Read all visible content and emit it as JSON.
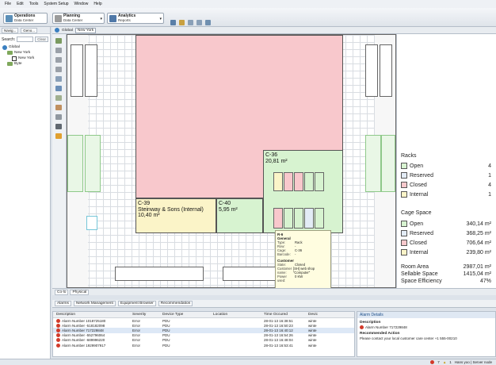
{
  "menu": [
    "File",
    "Edit",
    "Tools",
    "System Setup",
    "Window",
    "Help"
  ],
  "launchers": [
    {
      "title": "Operations",
      "sub": "Data Center"
    },
    {
      "title": "Planning",
      "sub": "Data Center"
    },
    {
      "title": "Analytics",
      "sub": "Reports"
    }
  ],
  "nav": {
    "tabs": [
      "Navig...",
      "Geno..."
    ],
    "search_label": "Search:",
    "clear_label": "Clear",
    "tree": [
      "Global",
      "New York",
      "New York",
      "Byte"
    ]
  },
  "editor": {
    "tab": "Global",
    "crumb": "New York"
  },
  "rooms": {
    "c36": {
      "name": "C-36",
      "area": "20,81 m²"
    },
    "c39": {
      "name": "C-39",
      "tenant": "Steinway & Sons (Internal)",
      "area": "10,40 m²"
    },
    "c40": {
      "name": "C-40",
      "area": "5,95 m²"
    }
  },
  "tooltip": {
    "title": "R-6",
    "general": "General",
    "rows": [
      [
        "Type:",
        "Rack"
      ],
      [
        "Row:",
        "-"
      ],
      [
        "Cage:",
        "C-36"
      ],
      [
        "Barcode:",
        "-"
      ]
    ],
    "customer": "Customer",
    "crows": [
      [
        "State:",
        "Closed"
      ],
      [
        "Customer name:",
        "[SH] web shop \"Computer\""
      ],
      [
        "Power used:",
        "0 KW"
      ]
    ]
  },
  "legend": {
    "racks_title": "Racks",
    "racks": [
      {
        "label": "Open",
        "value": "4",
        "color": "#d7f3d0"
      },
      {
        "label": "Reserved",
        "value": "1",
        "color": "#e3ecf6"
      },
      {
        "label": "Closed",
        "value": "4",
        "color": "#f8c8cc"
      },
      {
        "label": "Internal",
        "value": "1",
        "color": "#fbf4c8"
      }
    ],
    "cage_title": "Cage Space",
    "cages": [
      {
        "label": "Open",
        "value": "340,14 m²",
        "color": "#d7f3d0"
      },
      {
        "label": "Reserved",
        "value": "368,25 m²",
        "color": "#e3ecf6"
      },
      {
        "label": "Closed",
        "value": "706,64 m²",
        "color": "#f8c8cc"
      },
      {
        "label": "Internal",
        "value": "239,80 m²",
        "color": "#fbf4c8"
      }
    ],
    "room_area_label": "Room Area",
    "room_area": "2987,01 m²",
    "sellable_label": "Sellable Space",
    "sellable": "1415,04 m²",
    "efficiency_label": "Space Efficiency",
    "efficiency": "47%"
  },
  "bottom_tabs": [
    "Co-lo",
    "Physical"
  ],
  "alarm_tabs": [
    "Alarms",
    "Network Management",
    "Equipment Browser",
    "Recommendation"
  ],
  "alarm_columns": [
    "Description",
    "Severity",
    "Device Type",
    "Location",
    "Time Occured",
    "Devic"
  ],
  "alarms": [
    {
      "desc": "Alarm Number 1018725180",
      "sev": "Error",
      "type": "PDU",
      "loc": "",
      "time": "28-01-13 16:38:51",
      "dev": "winte"
    },
    {
      "desc": "Alarm Number -518182098",
      "sev": "Error",
      "type": "PDU",
      "loc": "",
      "time": "28-01-13 16:50:23",
      "dev": "winte"
    },
    {
      "desc": "Alarm Number 717229848",
      "sev": "Error",
      "type": "PDU",
      "loc": "",
      "time": "28-01-13 16:40:12",
      "dev": "winte"
    },
    {
      "desc": "Alarm Number -552796064",
      "sev": "Error",
      "type": "PDU",
      "loc": "",
      "time": "28-01-13 16:54:26",
      "dev": "winte"
    },
    {
      "desc": "Alarm Number -689996220",
      "sev": "Error",
      "type": "PDU",
      "loc": "",
      "time": "28-01-13 16:48:04",
      "dev": "winte"
    },
    {
      "desc": "Alarm Number 1929907917",
      "sev": "Error",
      "type": "PDU",
      "loc": "",
      "time": "28-01-13 16:53:41",
      "dev": "winte"
    }
  ],
  "details": {
    "header": "Alarm Details",
    "desc_title": "Description",
    "desc": "Alarm Number 717229848",
    "rec_title": "Recommended Action",
    "rec": "Please contact your local customer care center +1 555-00210"
  },
  "status": {
    "errors": "7",
    "warnings": "1",
    "user": "Hans yoo | Server node"
  }
}
